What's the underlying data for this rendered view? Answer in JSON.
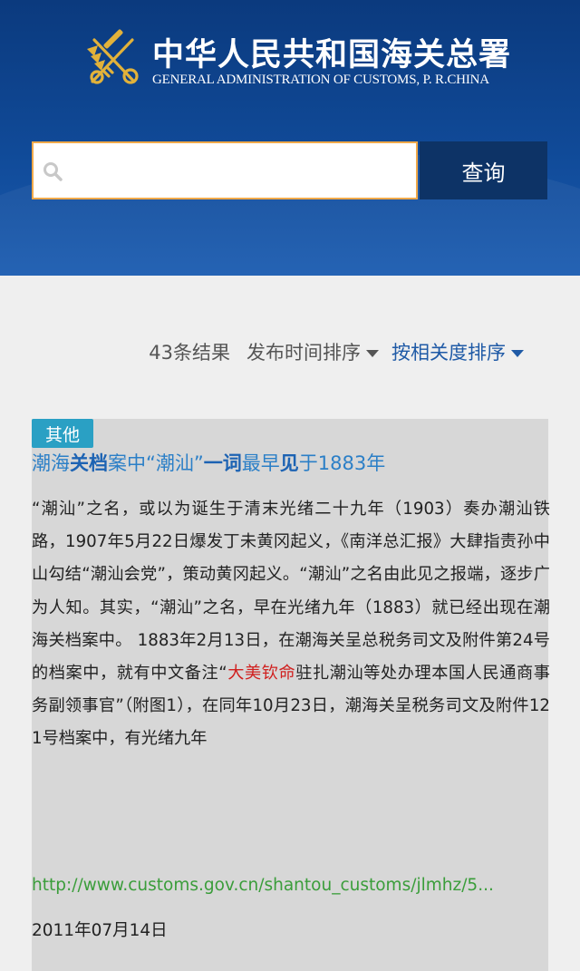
{
  "header": {
    "title_cn": "中华人民共和国海关总署",
    "title_en": "GENERAL ADMINISTRATION OF CUSTOMS, P. R.CHINA",
    "emblem_icon": "customs-emblem-icon",
    "colors": {
      "header_blue": "#104a98",
      "button_navy": "#0d3366",
      "input_border": "#f0a94a"
    }
  },
  "search": {
    "placeholder": "",
    "value": "",
    "button_label": "查询",
    "icon": "search-icon"
  },
  "sort_bar": {
    "result_count": "43条结果",
    "sort_by_time": "发布时间排序",
    "sort_by_relevance": "按相关度排序",
    "active": "sort_by_relevance"
  },
  "results": [
    {
      "tag": "其他",
      "title_parts": [
        "潮海",
        "关档",
        "案中“潮汕”",
        "一词",
        "最早",
        "见",
        "于1883年"
      ],
      "summary_before": "“潮汕”之名，或以为诞生于清末光绪二十九年（1903）奏办潮汕铁路，1907年5月22日爆发丁未黄冈起义，《南洋总汇报》大肆指责孙中山勾结“潮汕会党”，策动黄冈起义。“潮汕”之名由此见之报端，逐步广为人知。其实，“潮汕”之名，早在光绪九年（1883）就已经出现在潮海关档案中。 1883年2月13日，在潮海关呈总税务司文及附件第24号的档案中，就有中文备注“",
      "summary_highlight": "大美钦命",
      "summary_after": "驻扎潮汕等处办理本国人民通商事务副领事官”（附图1），在同年10月23日，潮海关呈税务司文及附件121号档案中，有光绪九年",
      "url": "http://www.customs.gov.cn/shantou_customs/jlmhz/5...",
      "date": "2011年07月14日"
    }
  ]
}
